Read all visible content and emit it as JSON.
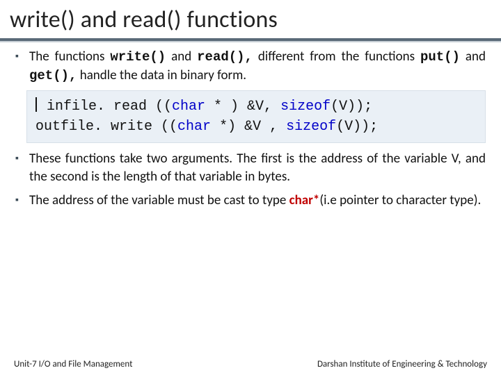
{
  "title": "write() and read() functions",
  "bullets": {
    "b1": {
      "pre": "The functions ",
      "fn1": "write()",
      "mid1": " and ",
      "fn2": "read(),",
      "mid2": " different from the functions ",
      "fn3": "put()",
      "mid3": " and ",
      "fn4": "get(),",
      "post": " handle the data in binary form."
    },
    "b2": "These functions take two arguments. The first is the address of the variable V, and the second is the length of that variable in bytes.",
    "b3": {
      "pre": "The address of the variable must be cast to type ",
      "kw": "char*",
      "post": "(i.e pointer to character type)."
    }
  },
  "code": {
    "l1_a": " infile. read ((",
    "l1_char": "char",
    "l1_b": " * ) &V, ",
    "l1_sz": "sizeof",
    "l1_c": "(V));",
    "l2_a": "outfile. write ((",
    "l2_char": "char",
    "l2_b": " *) &V , ",
    "l2_sz": "sizeof",
    "l2_c": "(V));"
  },
  "footer": {
    "left": "Unit-7 I/O and File Management",
    "right": "Darshan Institute of Engineering & Technology"
  }
}
